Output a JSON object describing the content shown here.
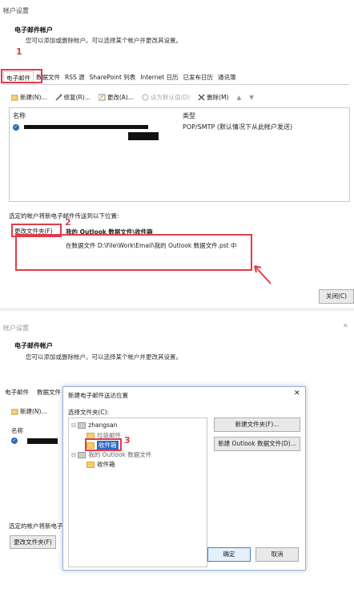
{
  "top": {
    "window_title": "帐户设置",
    "header_title": "电子邮件帐户",
    "header_sub": "您可以添加或删除帐户。可以选择某个帐户并更改其设置。",
    "annotation_1": "1",
    "tabs": [
      "电子邮件",
      "数据文件",
      "RSS 源",
      "SharePoint 列表",
      "Internet 日历",
      "已发布日历",
      "通讯簿"
    ],
    "toolbar": {
      "new": "新建(N)...",
      "repair": "修复(R)...",
      "change": "更改(A)...",
      "set_default": "设为默认值(D)",
      "remove": "删除(M)"
    },
    "col_name": "名称",
    "col_type": "类型",
    "account_type": "POP/SMTP (默认情况下从此帐户发送)",
    "deliver_label": "选定的帐户将新电子邮件传送到以下位置:",
    "change_folder": "更改文件夹(F)",
    "annotation_2": "2",
    "deliver_target": "我的 Outlook 数据文件\\收件箱",
    "data_path": "在数据文件 D:\\File\\Work\\Email\\我的 Outlook 数据文件.pst 中",
    "close": "关闭(C)"
  },
  "bottom": {
    "window_title": "帐户设置",
    "header_title": "电子邮件帐户",
    "header_sub": "您可以添加或删除帐户。可以选择某个帐户并更改其设置。",
    "tab_email": "电子邮件",
    "tab_data": "数据文件",
    "new": "新建(N)...",
    "col_name": "名称",
    "deliver_label": "选定的帐户将新电子",
    "change_folder": "更改文件夹(F)"
  },
  "dialog": {
    "title": "新建电子邮件送达位置",
    "select_label": "选择文件夹(C):",
    "account": "zhangsan",
    "junk": "垃圾邮件",
    "inbox": "收件箱",
    "annotation_3": "3",
    "datafile": "我的 Outlook 数据文件",
    "inbox2": "收件箱",
    "new_folder": "新建文件夹(F)...",
    "new_datafile": "新建 Outlook 数据文件(D)...",
    "ok": "确定",
    "cancel": "取消"
  }
}
